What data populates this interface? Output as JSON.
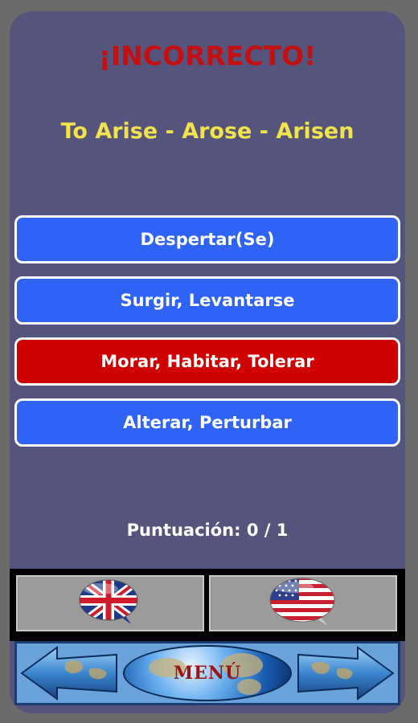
{
  "result": {
    "title": "¡INCORRECTO!",
    "title_color": "#c41010"
  },
  "question": {
    "verb_forms": "To Arise - Arose - Arisen",
    "color": "#f3e34a"
  },
  "options": [
    {
      "label": "Despertar(Se)",
      "state": "normal"
    },
    {
      "label": "Surgir, Levantarse",
      "state": "normal"
    },
    {
      "label": "Morar, Habitar, Tolerar",
      "state": "wrong"
    },
    {
      "label": "Alterar, Perturbar",
      "state": "normal"
    }
  ],
  "score": {
    "text": "Puntuación: 0 / 1"
  },
  "languages": {
    "left_icon": "uk-flag-bubble-icon",
    "right_icon": "us-flag-bubble-icon"
  },
  "navigation": {
    "menu_label": "MENÚ",
    "prev_icon": "left-arrow-icon",
    "next_icon": "right-arrow-icon"
  },
  "colors": {
    "option_blue": "#2f63f6",
    "option_wrong": "#cf0000",
    "background": "#55547c"
  }
}
